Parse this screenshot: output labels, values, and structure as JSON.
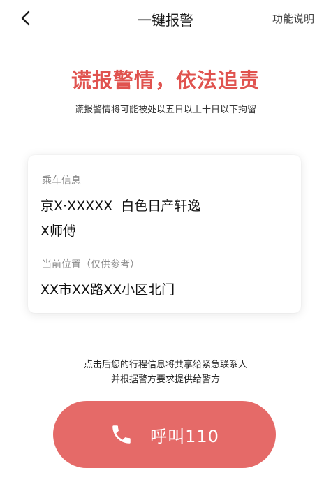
{
  "nav": {
    "back_icon": "chevron-left-icon",
    "title": "一键报警",
    "help_label": "功能说明"
  },
  "warning": {
    "headline": "谎报警情，依法追责",
    "subline": "谎报警情将可能被处以五日以上十日以下拘留"
  },
  "card": {
    "ride_label": "乘车信息",
    "vehicle": "京X·XXXXX  白色日产轩逸",
    "driver": "X师傅",
    "location_label": "当前位置（仅供参考）",
    "location": "XX市XX路XX小区北门"
  },
  "notice": {
    "line1": "点击后您的行程信息将共享给紧急联系人",
    "line2": "并根据警方要求提供给警方"
  },
  "call": {
    "icon": "phone-icon",
    "label": "呼叫110",
    "color": "#e56a68"
  },
  "colors": {
    "accent_red": "#e0534f"
  }
}
